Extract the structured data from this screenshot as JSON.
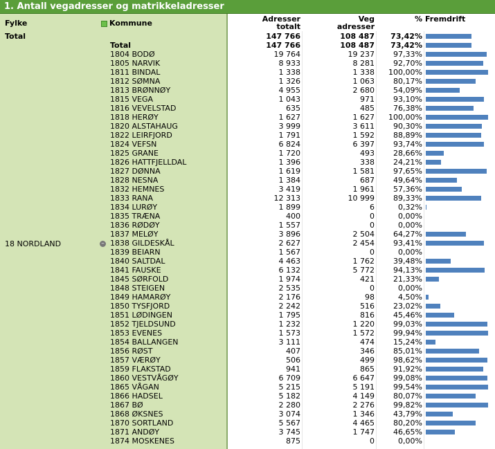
{
  "title": "1. Antall vegadresser og matrikkeladresser",
  "headers": {
    "fylke": "Fylke",
    "kommune": "Kommune",
    "adresser_line1": "Adresser",
    "adresser_line2": "totalt",
    "veg_line1": "Veg",
    "veg_line2": "adresser",
    "pct": "%",
    "fremdrift": "Fremdrift"
  },
  "grand_total": {
    "label": "Total",
    "adresser": "147 766",
    "veg": "108 487",
    "pct": "73,42%",
    "fraction": 0.7342
  },
  "fylke": "18 NORDLAND",
  "subtotal": {
    "label": "Total",
    "adresser": "147 766",
    "veg": "108 487",
    "pct": "73,42%",
    "fraction": 0.7342
  },
  "rows": [
    {
      "k": "1804 BODØ",
      "a": "19 764",
      "v": "19 237",
      "p": "97,33%",
      "f": 0.9733
    },
    {
      "k": "1805 NARVIK",
      "a": "8 933",
      "v": "8 281",
      "p": "92,70%",
      "f": 0.927
    },
    {
      "k": "1811 BINDAL",
      "a": "1 338",
      "v": "1 338",
      "p": "100,00%",
      "f": 1.0
    },
    {
      "k": "1812 SØMNA",
      "a": "1 326",
      "v": "1 063",
      "p": "80,17%",
      "f": 0.8017
    },
    {
      "k": "1813 BRØNNØY",
      "a": "4 955",
      "v": "2 680",
      "p": "54,09%",
      "f": 0.5409
    },
    {
      "k": "1815 VEGA",
      "a": "1 043",
      "v": "971",
      "p": "93,10%",
      "f": 0.931
    },
    {
      "k": "1816 VEVELSTAD",
      "a": "635",
      "v": "485",
      "p": "76,38%",
      "f": 0.7638
    },
    {
      "k": "1818 HERØY",
      "a": "1 627",
      "v": "1 627",
      "p": "100,00%",
      "f": 1.0
    },
    {
      "k": "1820 ALSTAHAUG",
      "a": "3 999",
      "v": "3 611",
      "p": "90,30%",
      "f": 0.903
    },
    {
      "k": "1822 LEIRFJORD",
      "a": "1 791",
      "v": "1 592",
      "p": "88,89%",
      "f": 0.8889
    },
    {
      "k": "1824 VEFSN",
      "a": "6 824",
      "v": "6 397",
      "p": "93,74%",
      "f": 0.9374
    },
    {
      "k": "1825 GRANE",
      "a": "1 720",
      "v": "493",
      "p": "28,66%",
      "f": 0.2866
    },
    {
      "k": "1826 HATTFJELLDAL",
      "a": "1 396",
      "v": "338",
      "p": "24,21%",
      "f": 0.2421
    },
    {
      "k": "1827 DØNNA",
      "a": "1 619",
      "v": "1 581",
      "p": "97,65%",
      "f": 0.9765
    },
    {
      "k": "1828 NESNA",
      "a": "1 384",
      "v": "687",
      "p": "49,64%",
      "f": 0.4964
    },
    {
      "k": "1832 HEMNES",
      "a": "3 419",
      "v": "1 961",
      "p": "57,36%",
      "f": 0.5736
    },
    {
      "k": "1833 RANA",
      "a": "12 313",
      "v": "10 999",
      "p": "89,33%",
      "f": 0.8933
    },
    {
      "k": "1834 LURØY",
      "a": "1 899",
      "v": "6",
      "p": "0,32%",
      "f": 0.0032
    },
    {
      "k": "1835 TRÆNA",
      "a": "400",
      "v": "0",
      "p": "0,00%",
      "f": 0.0
    },
    {
      "k": "1836 RØDØY",
      "a": "1 557",
      "v": "0",
      "p": "0,00%",
      "f": 0.0
    },
    {
      "k": "1837 MELØY",
      "a": "3 896",
      "v": "2 504",
      "p": "64,27%",
      "f": 0.6427
    },
    {
      "k": "1838 GILDESKÅL",
      "a": "2 627",
      "v": "2 454",
      "p": "93,41%",
      "f": 0.9341
    },
    {
      "k": "1839 BEIARN",
      "a": "1 567",
      "v": "0",
      "p": "0,00%",
      "f": 0.0
    },
    {
      "k": "1840 SALTDAL",
      "a": "4 463",
      "v": "1 762",
      "p": "39,48%",
      "f": 0.3948
    },
    {
      "k": "1841 FAUSKE",
      "a": "6 132",
      "v": "5 772",
      "p": "94,13%",
      "f": 0.9413
    },
    {
      "k": "1845 SØRFOLD",
      "a": "1 974",
      "v": "421",
      "p": "21,33%",
      "f": 0.2133
    },
    {
      "k": "1848 STEIGEN",
      "a": "2 535",
      "v": "0",
      "p": "0,00%",
      "f": 0.0
    },
    {
      "k": "1849 HAMARØY",
      "a": "2 176",
      "v": "98",
      "p": "4,50%",
      "f": 0.045
    },
    {
      "k": "1850 TYSFJORD",
      "a": "2 242",
      "v": "516",
      "p": "23,02%",
      "f": 0.2302
    },
    {
      "k": "1851 LØDINGEN",
      "a": "1 795",
      "v": "816",
      "p": "45,46%",
      "f": 0.4546
    },
    {
      "k": "1852 TJELDSUND",
      "a": "1 232",
      "v": "1 220",
      "p": "99,03%",
      "f": 0.9903
    },
    {
      "k": "1853 EVENES",
      "a": "1 573",
      "v": "1 572",
      "p": "99,94%",
      "f": 0.9994
    },
    {
      "k": "1854 BALLANGEN",
      "a": "3 111",
      "v": "474",
      "p": "15,24%",
      "f": 0.1524
    },
    {
      "k": "1856 RØST",
      "a": "407",
      "v": "346",
      "p": "85,01%",
      "f": 0.8501
    },
    {
      "k": "1857 VÆRØY",
      "a": "506",
      "v": "499",
      "p": "98,62%",
      "f": 0.9862
    },
    {
      "k": "1859 FLAKSTAD",
      "a": "941",
      "v": "865",
      "p": "91,92%",
      "f": 0.9192
    },
    {
      "k": "1860 VESTVÅGØY",
      "a": "6 709",
      "v": "6 647",
      "p": "99,08%",
      "f": 0.9908
    },
    {
      "k": "1865 VÅGAN",
      "a": "5 215",
      "v": "5 191",
      "p": "99,54%",
      "f": 0.9954
    },
    {
      "k": "1866 HADSEL",
      "a": "5 182",
      "v": "4 149",
      "p": "80,07%",
      "f": 0.8007
    },
    {
      "k": "1867 BØ",
      "a": "2 280",
      "v": "2 276",
      "p": "99,82%",
      "f": 0.9982
    },
    {
      "k": "1868 ØKSNES",
      "a": "3 074",
      "v": "1 346",
      "p": "43,79%",
      "f": 0.4379
    },
    {
      "k": "1870 SORTLAND",
      "a": "5 567",
      "v": "4 465",
      "p": "80,20%",
      "f": 0.802
    },
    {
      "k": "1871 ANDØY",
      "a": "3 745",
      "v": "1 747",
      "p": "46,65%",
      "f": 0.4665
    },
    {
      "k": "1874 MOSKENES",
      "a": "875",
      "v": "0",
      "p": "0,00%",
      "f": 0.0
    }
  ],
  "colors": {
    "title_bg": "#5a9e3a",
    "left_bg": "#d4e4b6",
    "bar": "#4f81bd"
  }
}
